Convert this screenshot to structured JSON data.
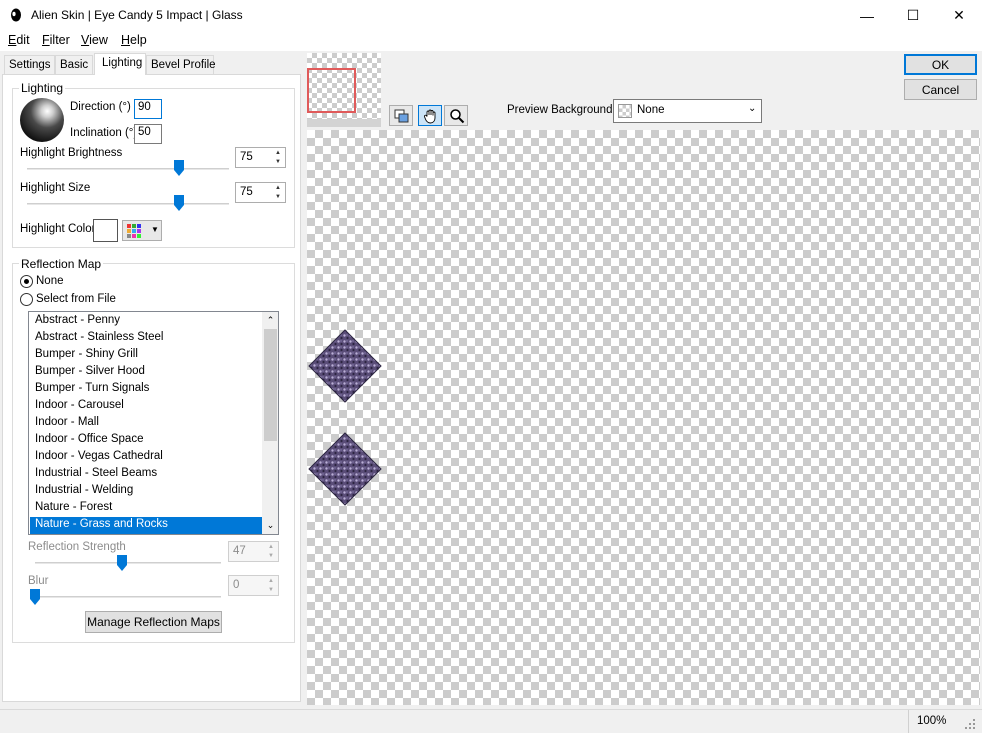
{
  "window": {
    "title": "Alien Skin | Eye Candy 5 Impact | Glass",
    "minimize": "—",
    "maximize": "☐",
    "close": "✕"
  },
  "menu": {
    "edit_first": "E",
    "edit_rest": "dit",
    "filter_first": "F",
    "filter_rest": "ilter",
    "view_first": "V",
    "view_rest": "iew",
    "help_first": "H",
    "help_rest": "elp"
  },
  "tabs": [
    "Settings",
    "Basic",
    "Lighting",
    "Bevel Profile"
  ],
  "lighting": {
    "group_label": "Lighting",
    "direction_label": "Direction (°)",
    "direction_value": "90",
    "inclination_label": "Inclination (°)",
    "inclination_value": "50",
    "highlight_brightness_label": "Highlight Brightness",
    "highlight_brightness_value": "75",
    "highlight_brightness_level": 0.75,
    "highlight_size_label": "Highlight Size",
    "highlight_size_value": "75",
    "highlight_size_level": 0.75,
    "highlight_color_label": "Highlight Color",
    "highlight_color": "#ffffff"
  },
  "reflection": {
    "group_label": "Reflection Map",
    "none_label": "None",
    "select_file_label": "Select from File",
    "items": [
      "Abstract - Penny",
      "Abstract - Stainless Steel",
      "Bumper - Shiny Grill",
      "Bumper - Silver Hood",
      "Bumper - Turn Signals",
      "Indoor - Carousel",
      "Indoor - Mall",
      "Indoor - Office Space",
      "Indoor - Vegas Cathedral",
      "Industrial - Steel Beams",
      "Industrial - Welding",
      "Nature - Forest",
      "Nature - Grass and Rocks"
    ],
    "selected_index": 12,
    "strength_label": "Reflection Strength",
    "strength_value": "47",
    "strength_level": 0.47,
    "blur_label": "Blur",
    "blur_value": "0",
    "blur_level": 0,
    "manage_button": "Manage Reflection Maps"
  },
  "buttons": {
    "ok": "OK",
    "cancel": "Cancel"
  },
  "preview": {
    "background_label": "Preview Background:",
    "background_value": "None"
  },
  "status": {
    "zoom": "100%"
  },
  "colors": {
    "accent": "#0078d7",
    "selection": "#0078d7",
    "navigator_frame": "#e05a5a",
    "tile_color": "#5a4d78"
  }
}
